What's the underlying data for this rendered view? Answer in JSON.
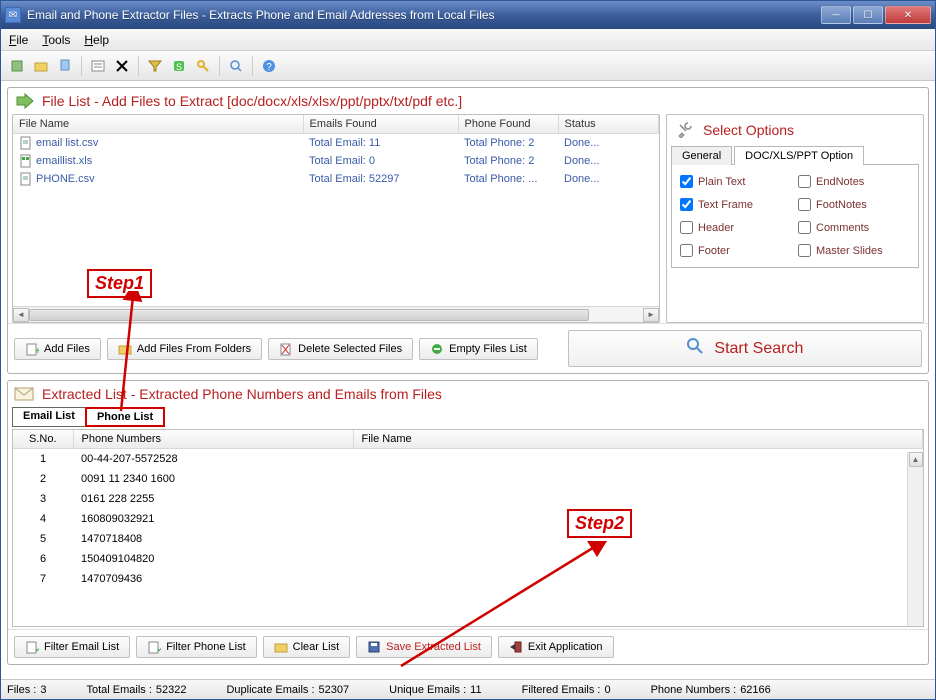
{
  "window": {
    "title": "Email and Phone Extractor Files  -  Extracts Phone and Email Addresses from Local Files"
  },
  "menus": {
    "file": "File",
    "tools": "Tools",
    "help": "Help"
  },
  "filelist": {
    "header": "File List - Add Files to Extract  [doc/docx/xls/xlsx/ppt/pptx/txt/pdf etc.]",
    "cols": {
      "name": "File Name",
      "emails": "Emails Found",
      "phone": "Phone Found",
      "status": "Status"
    },
    "rows": [
      {
        "name": "email list.csv",
        "emails": "Total Email: 11",
        "phone": "Total Phone: 2",
        "status": "Done..."
      },
      {
        "name": "emaillist.xls",
        "emails": "Total Email: 0",
        "phone": "Total Phone: 2",
        "status": "Done..."
      },
      {
        "name": "PHONE.csv",
        "emails": "Total Email: 52297",
        "phone": "Total Phone: ...",
        "status": "Done..."
      }
    ]
  },
  "options": {
    "title": "Select Options",
    "tab_general": "General",
    "tab_doc": "DOC/XLS/PPT Option",
    "items": {
      "plain": "Plain Text",
      "endnotes": "EndNotes",
      "textframe": "Text Frame",
      "footnotes": "FootNotes",
      "header": "Header",
      "comments": "Comments",
      "footer": "Footer",
      "master": "Master Slides"
    }
  },
  "file_buttons": {
    "add_files": "Add Files",
    "add_folders": "Add Files From Folders",
    "delete_selected": "Delete Selected Files",
    "empty": "Empty Files List",
    "start_search": "Start Search"
  },
  "extracted": {
    "header": "Extracted List - Extracted Phone Numbers and Emails from Files",
    "tab_email": "Email List",
    "tab_phone": "Phone List",
    "cols": {
      "sno": "S.No.",
      "phone": "Phone Numbers",
      "filename": "File Name"
    },
    "rows": [
      {
        "sno": "1",
        "phone": "00-44-207-5572528"
      },
      {
        "sno": "2",
        "phone": "0091 11 2340 1600"
      },
      {
        "sno": "3",
        "phone": "0161 228 2255"
      },
      {
        "sno": "4",
        "phone": "160809032921"
      },
      {
        "sno": "5",
        "phone": "1470718408"
      },
      {
        "sno": "6",
        "phone": "150409104820"
      },
      {
        "sno": "7",
        "phone": "1470709436"
      }
    ]
  },
  "bottom_buttons": {
    "filter_email": "Filter Email List",
    "filter_phone": "Filter Phone List",
    "clear": "Clear List",
    "save": "Save Extracted List",
    "exit": "Exit Application"
  },
  "status": {
    "files_lbl": "Files :",
    "files_val": "3",
    "te_lbl": "Total Emails :",
    "te_val": "52322",
    "de_lbl": "Duplicate Emails :",
    "de_val": "52307",
    "ue_lbl": "Unique Emails :",
    "ue_val": "11",
    "fe_lbl": "Filtered Emails :",
    "fe_val": "0",
    "pn_lbl": "Phone Numbers :",
    "pn_val": "62166"
  },
  "annotations": {
    "step1": "Step1",
    "step2": "Step2"
  }
}
